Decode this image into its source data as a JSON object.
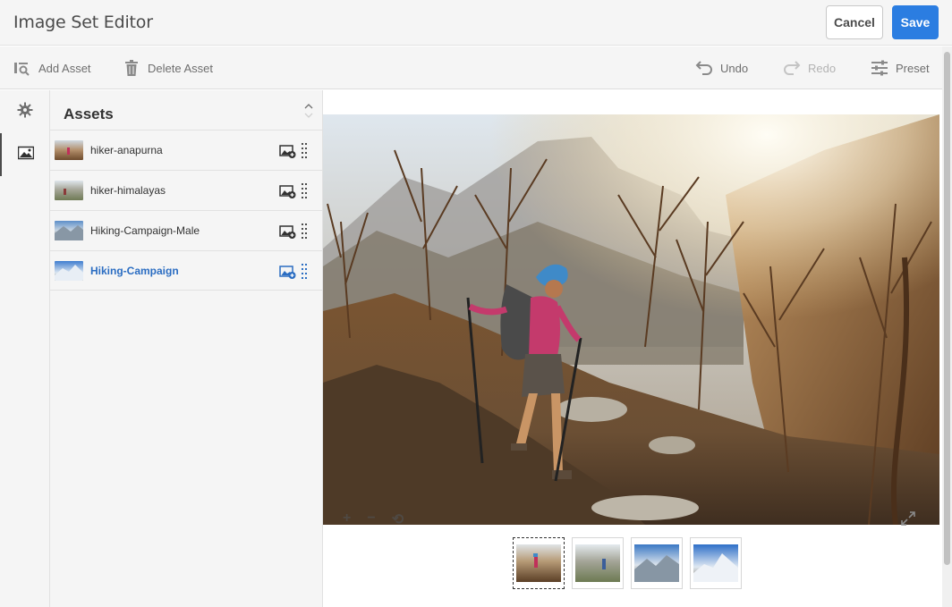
{
  "app": {
    "title": "Image Set Editor"
  },
  "header": {
    "cancel_label": "Cancel",
    "save_label": "Save"
  },
  "toolbar": {
    "add_asset": {
      "label": "Add Asset",
      "icon": "add-asset-icon"
    },
    "delete_asset": {
      "label": "Delete Asset",
      "icon": "trash-icon"
    },
    "undo": {
      "label": "Undo",
      "icon": "undo-icon"
    },
    "redo": {
      "label": "Redo",
      "icon": "redo-icon"
    },
    "preset": {
      "label": "Preset",
      "icon": "sliders-icon"
    }
  },
  "rail": {
    "items": [
      {
        "icon": "gear-icon"
      },
      {
        "icon": "image-icon",
        "active": true
      }
    ]
  },
  "assets": {
    "title": "Assets",
    "items": [
      {
        "name": "hiker-anapurna",
        "selected": false
      },
      {
        "name": "hiker-himalayas",
        "selected": false
      },
      {
        "name": "Hiking-Campaign-Male",
        "selected": false
      },
      {
        "name": "Hiking-Campaign",
        "selected": true
      }
    ]
  },
  "preview": {
    "zoom_in_label": "+",
    "zoom_out_label": "−",
    "reset_label": "⟲",
    "thumbnails": [
      {
        "name": "hiker-anapurna",
        "selected": true
      },
      {
        "name": "hiker-himalayas",
        "selected": false
      },
      {
        "name": "Hiking-Campaign-Male",
        "selected": false
      },
      {
        "name": "Hiking-Campaign",
        "selected": false
      }
    ]
  },
  "colors": {
    "accent": "#2b7de1",
    "selected_text": "#2b6dc2"
  }
}
